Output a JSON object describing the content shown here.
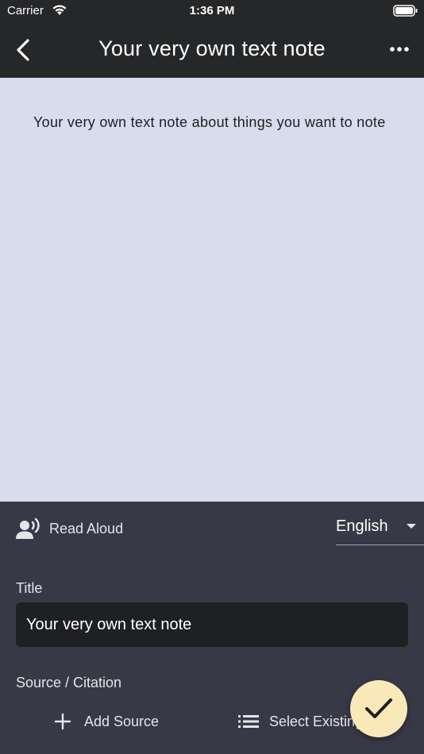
{
  "status_bar": {
    "carrier": "Carrier",
    "time": "1:36 PM"
  },
  "app_bar": {
    "title": "Your very own text note",
    "back_icon": "chevron-left-icon",
    "more_icon": "more-horizontal-icon"
  },
  "note": {
    "body": "Your very own text note about things you want to note"
  },
  "panel": {
    "read_aloud_label": "Read Aloud",
    "language": "English",
    "title_label": "Title",
    "title_value": "Your very own text note",
    "source_label": "Source / Citation",
    "add_source_label": "Add Source",
    "select_existing_label": "Select Existing"
  },
  "colors": {
    "app_bar_bg": "#262729",
    "note_bg": "#d8dcec",
    "panel_bg": "#373946",
    "input_bg": "#1f2023",
    "fab_bg": "#f9e9b8"
  }
}
